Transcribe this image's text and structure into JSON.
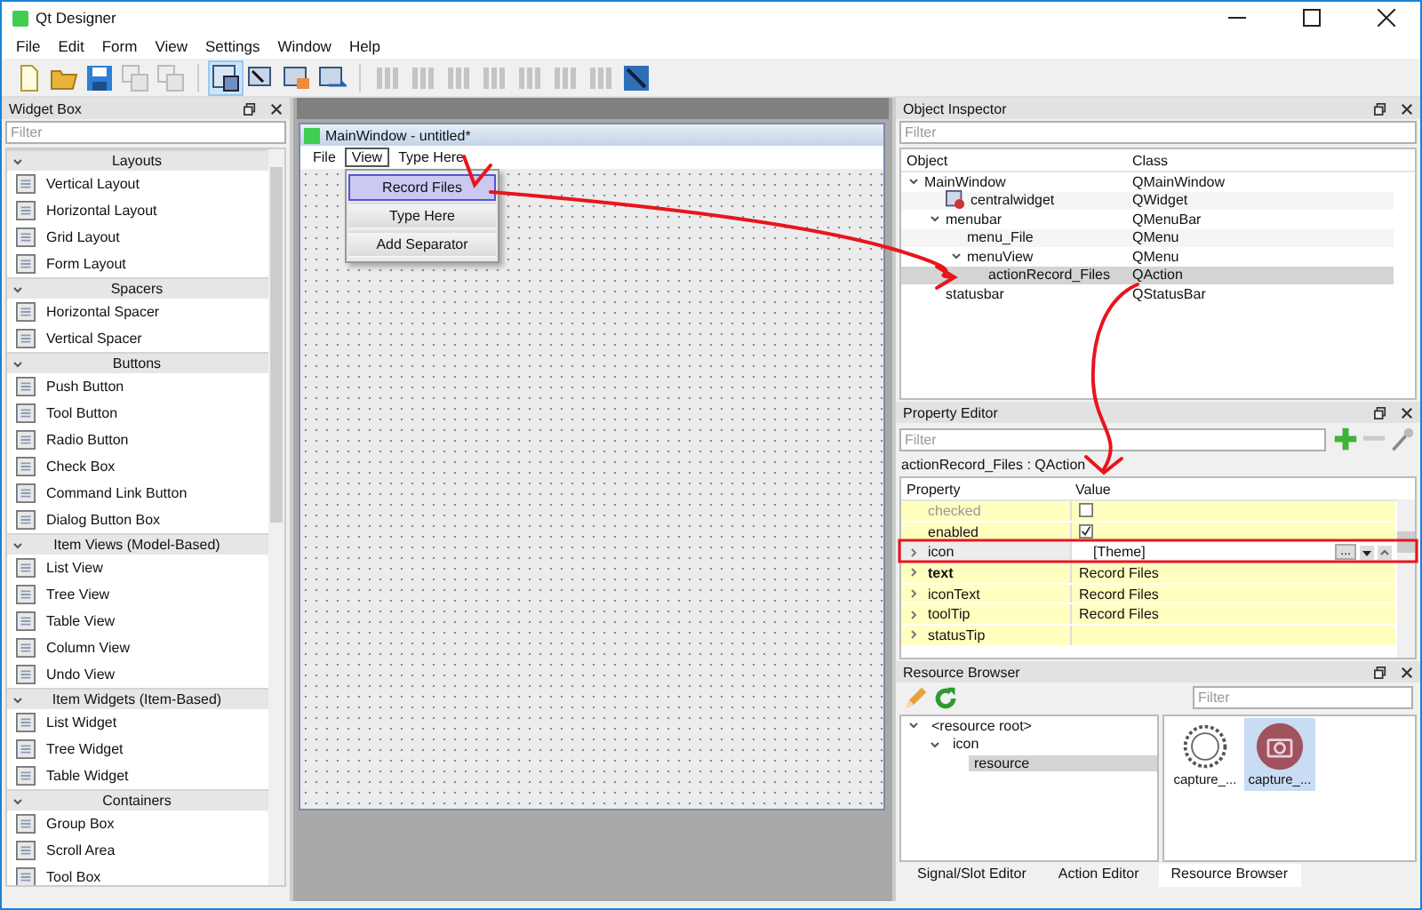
{
  "window": {
    "title": "Qt Designer"
  },
  "menu": [
    "File",
    "Edit",
    "Form",
    "View",
    "Settings",
    "Window",
    "Help"
  ],
  "widget_box": {
    "title": "Widget Box",
    "filter_placeholder": "Filter",
    "groups": [
      {
        "title": "Layouts",
        "expanded": true,
        "items": [
          "Vertical Layout",
          "Horizontal Layout",
          "Grid Layout",
          "Form Layout"
        ]
      },
      {
        "title": "Spacers",
        "expanded": true,
        "items": [
          "Horizontal Spacer",
          "Vertical Spacer"
        ]
      },
      {
        "title": "Buttons",
        "expanded": true,
        "items": [
          "Push Button",
          "Tool Button",
          "Radio Button",
          "Check Box",
          "Command Link Button",
          "Dialog Button Box"
        ]
      },
      {
        "title": "Item Views (Model-Based)",
        "expanded": true,
        "items": [
          "List View",
          "Tree View",
          "Table View",
          "Column View",
          "Undo View"
        ]
      },
      {
        "title": "Item Widgets (Item-Based)",
        "expanded": true,
        "items": [
          "List Widget",
          "Tree Widget",
          "Table Widget"
        ]
      },
      {
        "title": "Containers",
        "expanded": true,
        "items": [
          "Group Box",
          "Scroll Area",
          "Tool Box"
        ]
      }
    ]
  },
  "form": {
    "title": "MainWindow - untitled*",
    "menus": [
      {
        "label": "File",
        "selected": false
      },
      {
        "label": "View",
        "selected": true
      },
      {
        "label": "Type Here",
        "selected": false
      }
    ],
    "dropdown": [
      {
        "label": "Record Files",
        "selected": true
      },
      {
        "label": "Type Here",
        "selected": false
      },
      {
        "label": "Add Separator",
        "selected": false
      }
    ]
  },
  "object_inspector": {
    "title": "Object Inspector",
    "filter_placeholder": "Filter",
    "columns": [
      "Object",
      "Class"
    ],
    "tree": [
      {
        "name": "MainWindow",
        "class": "QMainWindow",
        "expanded": true,
        "selected": false,
        "children": [
          {
            "name": "centralwidget",
            "class": "QWidget",
            "kind": "widget",
            "selected": false
          },
          {
            "name": "menubar",
            "class": "QMenuBar",
            "expanded": true,
            "selected": false,
            "children": [
              {
                "name": "menu_File",
                "class": "QMenu",
                "selected": false
              },
              {
                "name": "menuView",
                "class": "QMenu",
                "expanded": true,
                "selected": false,
                "children": [
                  {
                    "name": "actionRecord_Files",
                    "class": "QAction",
                    "selected": true
                  }
                ]
              }
            ]
          },
          {
            "name": "statusbar",
            "class": "QStatusBar",
            "selected": false
          }
        ]
      }
    ]
  },
  "property_editor": {
    "title": "Property Editor",
    "filter_placeholder": "Filter",
    "object_label": "actionRecord_Files : QAction",
    "columns": [
      "Property",
      "Value"
    ],
    "rows": [
      {
        "name": "checked",
        "kind": "checkbox",
        "checked": false,
        "disabled": true,
        "expandable": false,
        "modified": false,
        "selected": false
      },
      {
        "name": "enabled",
        "kind": "checkbox",
        "checked": true,
        "disabled": false,
        "expandable": false,
        "modified": false,
        "selected": false
      },
      {
        "name": "icon",
        "kind": "icon",
        "value": "[Theme]",
        "button": "...",
        "disabled": false,
        "expandable": true,
        "modified": false,
        "selected": true
      },
      {
        "name": "text",
        "kind": "text",
        "value": "Record Files",
        "disabled": false,
        "expandable": true,
        "modified": true,
        "selected": false
      },
      {
        "name": "iconText",
        "kind": "text",
        "value": "Record Files",
        "disabled": false,
        "expandable": true,
        "modified": false,
        "selected": false
      },
      {
        "name": "toolTip",
        "kind": "text",
        "value": "Record Files",
        "disabled": false,
        "expandable": true,
        "modified": false,
        "selected": false
      },
      {
        "name": "statusTip",
        "kind": "text",
        "disabled": false,
        "expandable": true,
        "modified": false,
        "selected": false
      }
    ]
  },
  "resource_browser": {
    "title": "Resource Browser",
    "filter_placeholder": "Filter",
    "tree": [
      {
        "label": "<resource root>",
        "expanded": true,
        "selected": false,
        "children": [
          {
            "label": "icon",
            "expanded": true,
            "selected": false,
            "children": [
              {
                "label": "resource",
                "selected": true
              }
            ]
          }
        ]
      }
    ],
    "files": [
      {
        "label": "capture_...",
        "kind": "timer",
        "selected": false
      },
      {
        "label": "capture_...",
        "kind": "camera",
        "selected": true
      }
    ]
  },
  "bottom_tabs": [
    {
      "label": "Signal/Slot Editor",
      "selected": false
    },
    {
      "label": "Action Editor",
      "selected": false
    },
    {
      "label": "Resource Browser",
      "selected": true
    }
  ]
}
